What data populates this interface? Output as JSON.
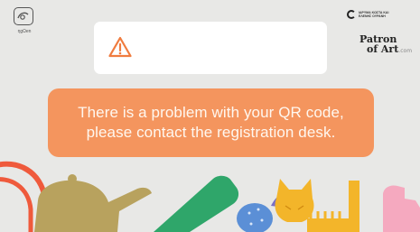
{
  "logo": {
    "caption": "ηgΩen",
    "icon": "qr-scanner-logo-icon"
  },
  "alert": {
    "icon": "warning-triangle-icon",
    "text": ""
  },
  "message": {
    "line1": "There is a problem with your QR code,",
    "line2": "please contact the registration desk."
  },
  "sponsors": {
    "top_line1": "ΙΔΡΥΜΑ ΚΩΣΤΑ ΚΑΙ",
    "top_line2": "ΕΛΕΝΗΣ ΟΥΡΑΝΗ",
    "patron_line1": "Patron",
    "patron_line2": "of Art",
    "patron_domain": ".com"
  },
  "colors": {
    "background": "#e8e8e6",
    "banner": "#f4955e",
    "banner_text": "#fff7ef",
    "warning": "#f07c3f"
  }
}
